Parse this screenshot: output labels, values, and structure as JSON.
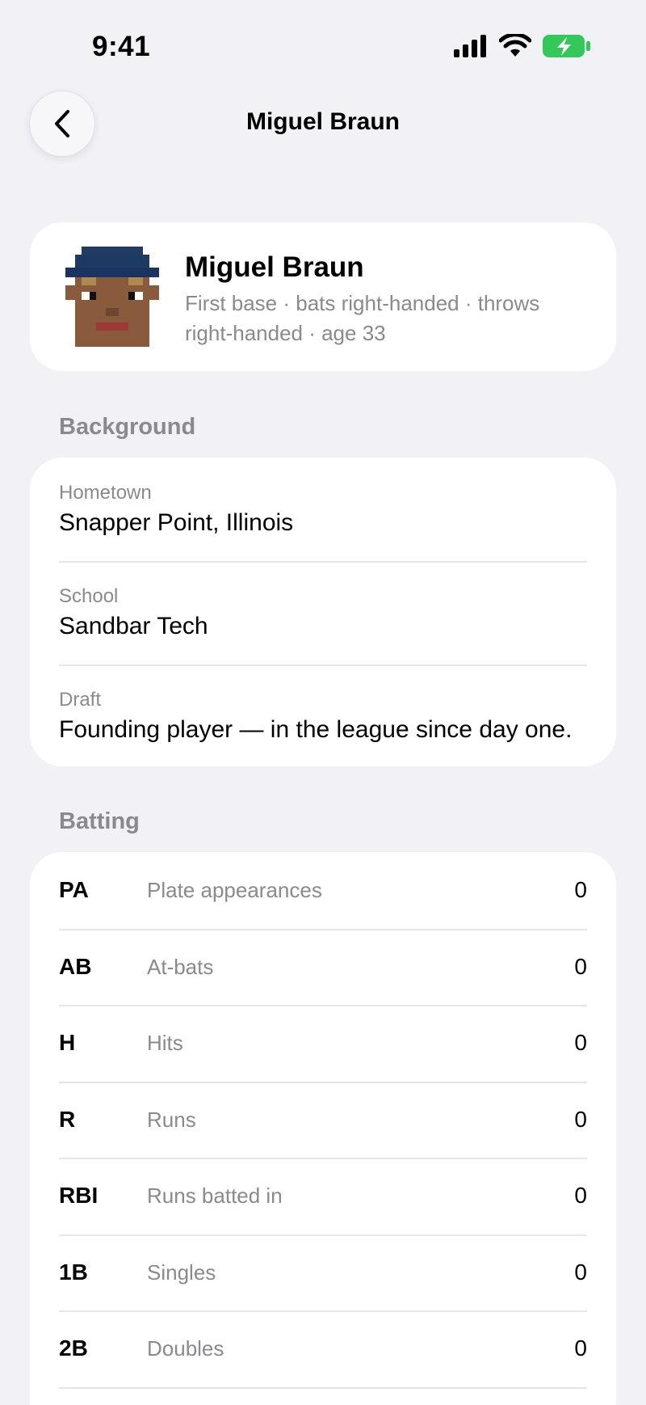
{
  "status_bar": {
    "time": "9:41"
  },
  "nav": {
    "title": "Miguel Braun"
  },
  "profile": {
    "name": "Miguel Braun",
    "description": "First base · bats right-handed · throws right-handed · age 33"
  },
  "background": {
    "header": "Background",
    "rows": [
      {
        "label": "Hometown",
        "value": "Snapper Point, Illinois"
      },
      {
        "label": "School",
        "value": "Sandbar Tech"
      },
      {
        "label": "Draft",
        "value": "Founding player — in the league since day one."
      }
    ]
  },
  "batting": {
    "header": "Batting",
    "rows": [
      {
        "abbr": "PA",
        "desc": "Plate appearances",
        "value": "0"
      },
      {
        "abbr": "AB",
        "desc": "At-bats",
        "value": "0"
      },
      {
        "abbr": "H",
        "desc": "Hits",
        "value": "0"
      },
      {
        "abbr": "R",
        "desc": "Runs",
        "value": "0"
      },
      {
        "abbr": "RBI",
        "desc": "Runs batted in",
        "value": "0"
      },
      {
        "abbr": "1B",
        "desc": "Singles",
        "value": "0"
      },
      {
        "abbr": "2B",
        "desc": "Doubles",
        "value": "0"
      }
    ]
  },
  "colors": {
    "background": "#f1f1f6",
    "card": "#ffffff",
    "secondary_text": "#8a8a8e",
    "battery": "#34c759"
  },
  "icons": [
    "cellular-signal-icon",
    "wifi-icon",
    "battery-charging-icon",
    "chevron-left-icon",
    "pixel-avatar"
  ]
}
